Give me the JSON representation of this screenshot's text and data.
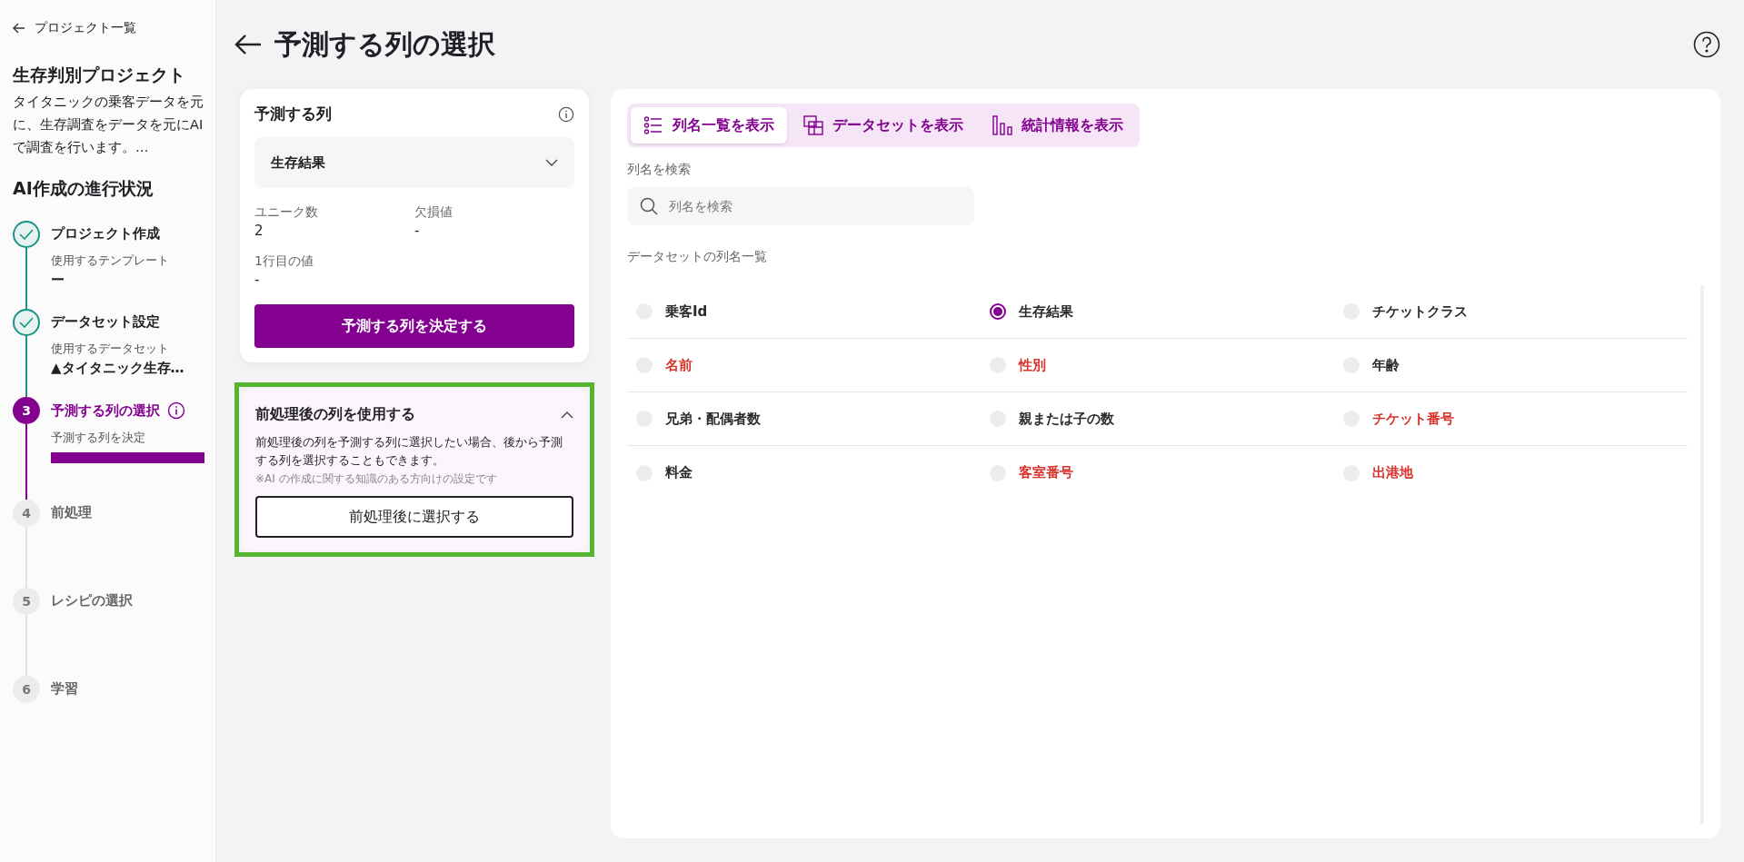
{
  "sidebar": {
    "back_link": "プロジェクト一覧",
    "project_title": "生存判別プロジェクト",
    "project_description": "タイタニックの乗客データを元に、生存調査をデータを元にAIで調査を行います。…",
    "progress_heading": "AI作成の進行状況",
    "steps": [
      {
        "title": "プロジェクト作成",
        "kind": "done",
        "caption": "使用するテンプレート",
        "value": "ー"
      },
      {
        "title": "データセット設定",
        "kind": "done",
        "caption": "使用するデータセット",
        "value": "▲タイタニック生存…"
      },
      {
        "number": "3",
        "title": "予測する列の選択",
        "kind": "current",
        "caption": "予測する列を決定",
        "level": 1
      },
      {
        "number": "4",
        "title": "前処理",
        "kind": "pending"
      },
      {
        "number": "5",
        "title": "レシピの選択",
        "kind": "pending"
      },
      {
        "number": "6",
        "title": "学習",
        "kind": "pending"
      }
    ]
  },
  "page": {
    "title": "予測する列の選択"
  },
  "target_card": {
    "title": "予測する列",
    "dropdown_value": "生存結果",
    "stats": [
      {
        "label": "ユニーク数",
        "value": "2"
      },
      {
        "label": "欠損値",
        "value": "-"
      },
      {
        "label": "1行目の値",
        "value": "-"
      }
    ],
    "confirm_button": "予測する列を決定する"
  },
  "preprocess_card": {
    "title": "前処理後の列を使用する",
    "expanded": true,
    "highlighted": true,
    "description": "前処理後の列を予測する列に選択したい場合、後から予測する列を選択することもできます。",
    "note": "※AI の作成に関する知識のある方向けの設定です",
    "button": "前処理後に選択する"
  },
  "view_tabs": [
    {
      "label": "列名一覧を表示",
      "kind": "list",
      "selected": true
    },
    {
      "label": "データセットを表示",
      "kind": "table",
      "selected": false
    },
    {
      "label": "統計情報を表示",
      "kind": "bars",
      "selected": false
    }
  ],
  "search": {
    "label": "列名を検索",
    "placeholder": "列名を検索"
  },
  "columns_heading": "データセットの列名一覧",
  "columns": [
    {
      "name": "乗客Id",
      "selected": false,
      "flagged": false
    },
    {
      "name": "生存結果",
      "selected": true,
      "flagged": false
    },
    {
      "name": "チケットクラス",
      "selected": false,
      "flagged": false
    },
    {
      "name": "名前",
      "selected": false,
      "flagged": true
    },
    {
      "name": "性別",
      "selected": false,
      "flagged": true
    },
    {
      "name": "年齢",
      "selected": false,
      "flagged": false
    },
    {
      "name": "兄弟・配偶者数",
      "selected": false,
      "flagged": false
    },
    {
      "name": "親または子の数",
      "selected": false,
      "flagged": false
    },
    {
      "name": "チケット番号",
      "selected": false,
      "flagged": true
    },
    {
      "name": "料金",
      "selected": false,
      "flagged": false
    },
    {
      "name": "客室番号",
      "selected": false,
      "flagged": true
    },
    {
      "name": "出港地",
      "selected": false,
      "flagged": true
    }
  ]
}
